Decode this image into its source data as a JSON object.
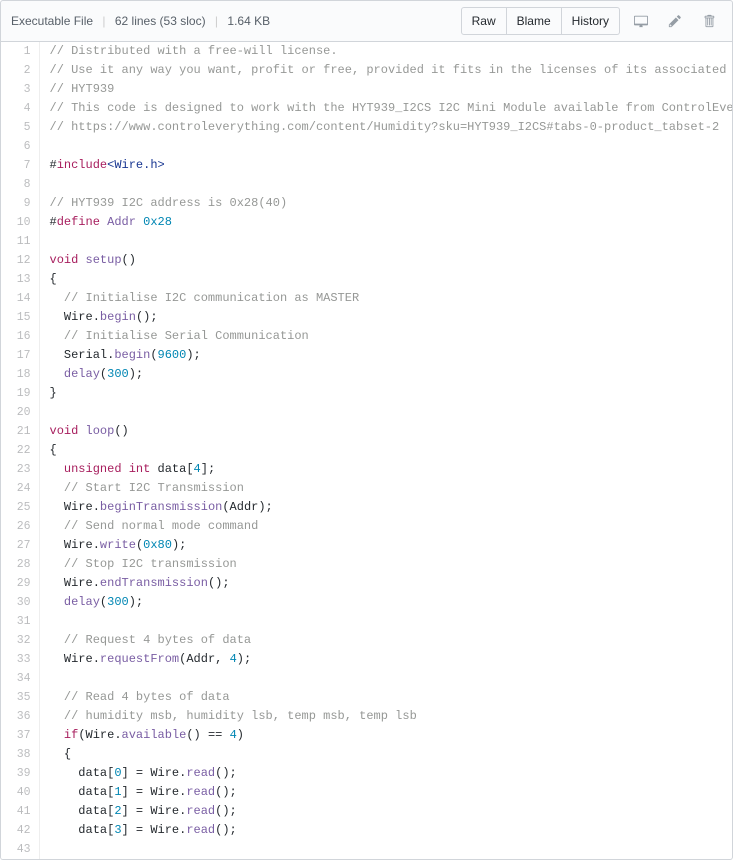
{
  "header": {
    "file_type": "Executable File",
    "line_info": "62 lines (53 sloc)",
    "size": "1.64 KB",
    "raw_label": "Raw",
    "blame_label": "Blame",
    "history_label": "History"
  },
  "code": [
    {
      "n": 1,
      "html": "<span class='pl-c'>// Distributed with a free-will license.</span>"
    },
    {
      "n": 2,
      "html": "<span class='pl-c'>// Use it any way you want, profit or free, provided it fits in the licenses of its associated works.</span>"
    },
    {
      "n": 3,
      "html": "<span class='pl-c'>// HYT939</span>"
    },
    {
      "n": 4,
      "html": "<span class='pl-c'>// This code is designed to work with the HYT939_I2CS I2C Mini Module available from ControlEverything.com.</span>"
    },
    {
      "n": 5,
      "html": "<span class='pl-c'>// https://www.controleverything.com/content/Humidity?sku=HYT939_I2CS#tabs-0-product_tabset-2</span>"
    },
    {
      "n": 6,
      "html": ""
    },
    {
      "n": 7,
      "html": "#<span class='pl-k'>include</span><span class='pl-s'>&lt;Wire.h&gt;</span>"
    },
    {
      "n": 8,
      "html": ""
    },
    {
      "n": 9,
      "html": "<span class='pl-c'>// HYT939 I2C address is 0x28(40)</span>"
    },
    {
      "n": 10,
      "html": "#<span class='pl-k'>define</span> <span class='pl-en'>Addr</span> <span class='pl-c1'>0x28</span>"
    },
    {
      "n": 11,
      "html": ""
    },
    {
      "n": 12,
      "html": "<span class='pl-k'>void</span> <span class='pl-en'>setup</span>()"
    },
    {
      "n": 13,
      "html": "{"
    },
    {
      "n": 14,
      "html": "  <span class='pl-c'>// Initialise I2C communication as MASTER</span>"
    },
    {
      "n": 15,
      "html": "  Wire.<span class='pl-en'>begin</span>();"
    },
    {
      "n": 16,
      "html": "  <span class='pl-c'>// Initialise Serial Communication</span>"
    },
    {
      "n": 17,
      "html": "  Serial.<span class='pl-en'>begin</span>(<span class='pl-c1'>9600</span>);"
    },
    {
      "n": 18,
      "html": "  <span class='pl-en'>delay</span>(<span class='pl-c1'>300</span>);"
    },
    {
      "n": 19,
      "html": "}"
    },
    {
      "n": 20,
      "html": ""
    },
    {
      "n": 21,
      "html": "<span class='pl-k'>void</span> <span class='pl-en'>loop</span>()"
    },
    {
      "n": 22,
      "html": "{"
    },
    {
      "n": 23,
      "html": "  <span class='pl-k'>unsigned</span> <span class='pl-k'>int</span> data[<span class='pl-c1'>4</span>];"
    },
    {
      "n": 24,
      "html": "  <span class='pl-c'>// Start I2C Transmission</span>"
    },
    {
      "n": 25,
      "html": "  Wire.<span class='pl-en'>beginTransmission</span>(Addr);"
    },
    {
      "n": 26,
      "html": "  <span class='pl-c'>// Send normal mode command</span>"
    },
    {
      "n": 27,
      "html": "  Wire.<span class='pl-en'>write</span>(<span class='pl-c1'>0x80</span>);"
    },
    {
      "n": 28,
      "html": "  <span class='pl-c'>// Stop I2C transmission</span>"
    },
    {
      "n": 29,
      "html": "  Wire.<span class='pl-en'>endTransmission</span>();"
    },
    {
      "n": 30,
      "html": "  <span class='pl-en'>delay</span>(<span class='pl-c1'>300</span>);"
    },
    {
      "n": 31,
      "html": ""
    },
    {
      "n": 32,
      "html": "  <span class='pl-c'>// Request 4 bytes of data</span>"
    },
    {
      "n": 33,
      "html": "  Wire.<span class='pl-en'>requestFrom</span>(Addr, <span class='pl-c1'>4</span>);"
    },
    {
      "n": 34,
      "html": ""
    },
    {
      "n": 35,
      "html": "  <span class='pl-c'>// Read 4 bytes of data</span>"
    },
    {
      "n": 36,
      "html": "  <span class='pl-c'>// humidity msb, humidity lsb, temp msb, temp lsb</span>"
    },
    {
      "n": 37,
      "html": "  <span class='pl-k'>if</span>(Wire.<span class='pl-en'>available</span>() == <span class='pl-c1'>4</span>)"
    },
    {
      "n": 38,
      "html": "  {"
    },
    {
      "n": 39,
      "html": "    data[<span class='pl-c1'>0</span>] = Wire.<span class='pl-en'>read</span>();"
    },
    {
      "n": 40,
      "html": "    data[<span class='pl-c1'>1</span>] = Wire.<span class='pl-en'>read</span>();"
    },
    {
      "n": 41,
      "html": "    data[<span class='pl-c1'>2</span>] = Wire.<span class='pl-en'>read</span>();"
    },
    {
      "n": 42,
      "html": "    data[<span class='pl-c1'>3</span>] = Wire.<span class='pl-en'>read</span>();"
    },
    {
      "n": 43,
      "html": ""
    }
  ]
}
